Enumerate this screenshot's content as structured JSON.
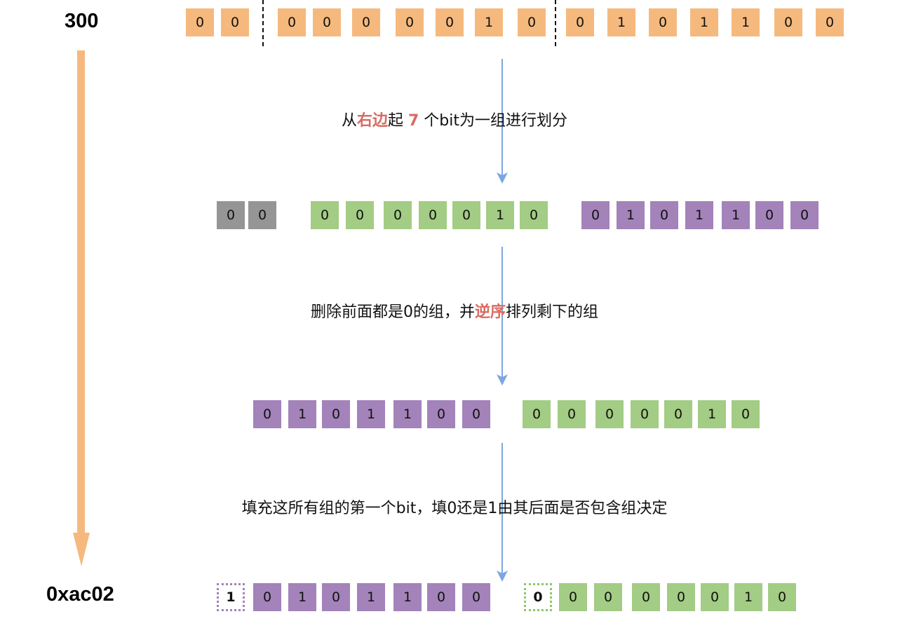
{
  "labels": {
    "top": "300",
    "bottom": "0xac02"
  },
  "captions": [
    {
      "parts": [
        {
          "text": "从"
        },
        {
          "text": "右边",
          "hl": true
        },
        {
          "text": "起 "
        },
        {
          "text": "7",
          "hl": true
        },
        {
          "text": " 个bit为一组进行划分"
        }
      ]
    },
    {
      "parts": [
        {
          "text": "删除前面都是0的组，并"
        },
        {
          "text": "逆序",
          "hl": true
        },
        {
          "text": "排列剩下的组"
        }
      ]
    },
    {
      "parts": [
        {
          "text": "填充这所有组的第一个bit，填0还是1由其后面是否包含组决定"
        }
      ]
    }
  ],
  "rows": [
    {
      "name": "original-bits",
      "groups": [
        {
          "color": "orange",
          "bits": [
            "0",
            "0"
          ]
        },
        {
          "color": "orange",
          "bits": [
            "0",
            "0",
            "0",
            "0",
            "0",
            "1",
            "0"
          ]
        },
        {
          "color": "orange",
          "bits": [
            "0",
            "1",
            "0",
            "1",
            "1",
            "0",
            "0"
          ]
        }
      ]
    },
    {
      "name": "split-groups",
      "groups": [
        {
          "color": "gray",
          "bits": [
            "0",
            "0"
          ]
        },
        {
          "color": "green",
          "bits": [
            "0",
            "0",
            "0",
            "0",
            "0",
            "1",
            "0"
          ]
        },
        {
          "color": "purple",
          "bits": [
            "0",
            "1",
            "0",
            "1",
            "1",
            "0",
            "0"
          ]
        }
      ]
    },
    {
      "name": "reversed-groups",
      "groups": [
        {
          "color": "purple",
          "bits": [
            "0",
            "1",
            "0",
            "1",
            "1",
            "0",
            "0"
          ]
        },
        {
          "color": "green",
          "bits": [
            "0",
            "0",
            "0",
            "0",
            "0",
            "1",
            "0"
          ]
        }
      ]
    },
    {
      "name": "filled-groups",
      "groups": [
        {
          "color": "purple",
          "msb": "1",
          "bits": [
            "0",
            "1",
            "0",
            "1",
            "1",
            "0",
            "0"
          ]
        },
        {
          "color": "green",
          "msb": "0",
          "bits": [
            "0",
            "0",
            "0",
            "0",
            "0",
            "1",
            "0"
          ]
        }
      ]
    }
  ],
  "colors": {
    "orange": "#F5B97E",
    "gray": "#959595",
    "green": "#A3CC84",
    "purple": "#A383BA",
    "highlight": "#D96A63",
    "arrow": "#7EA6E0",
    "bigArrow": "#F5B97E",
    "purpleBorder": "#A383BA",
    "greenBorder": "#8CC66A"
  }
}
